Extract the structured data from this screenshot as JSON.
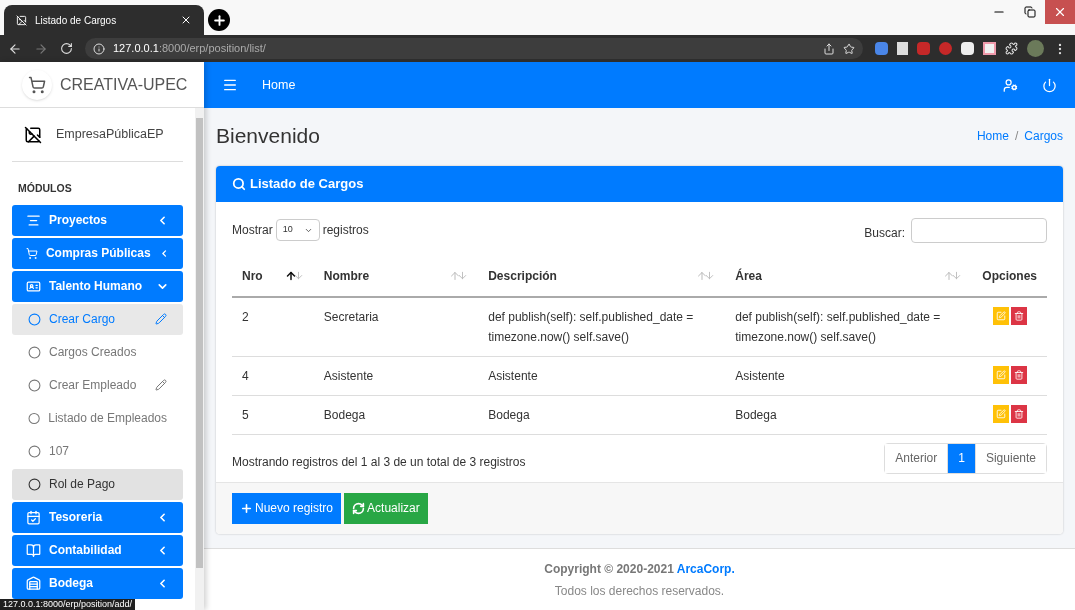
{
  "browser": {
    "tab_title": "Listado de Cargos",
    "address_host": "127.0.0.1",
    "address_path": ":8000/erp/position/list/",
    "status_url": "127.0.0.1:8000/erp/position/add/"
  },
  "sidebar": {
    "brand": "CREATIVA-UPEC",
    "company": "EmpresaPúblicaEP",
    "section": "MÓDULOS",
    "items": [
      {
        "kind": "module",
        "label": "Proyectos",
        "expanded": false
      },
      {
        "kind": "module",
        "label": "Compras Públicas",
        "expanded": false
      },
      {
        "kind": "module",
        "label": "Talento Humano",
        "expanded": true
      },
      {
        "kind": "subitem",
        "label": "Crear Cargo",
        "selected": true,
        "hovered": false,
        "edit_icon": true
      },
      {
        "kind": "subitem",
        "label": "Cargos Creados",
        "selected": false,
        "hovered": false,
        "edit_icon": false
      },
      {
        "kind": "subitem",
        "label": "Crear Empleado",
        "selected": false,
        "hovered": false,
        "edit_icon": true
      },
      {
        "kind": "subitem",
        "label": "Listado de Empleados",
        "selected": false,
        "hovered": false,
        "edit_icon": false
      },
      {
        "kind": "subitem",
        "label": "107",
        "selected": false,
        "hovered": false,
        "edit_icon": false
      },
      {
        "kind": "subitem",
        "label": "Rol de Pago",
        "selected": false,
        "hovered": true,
        "edit_icon": false
      },
      {
        "kind": "module",
        "label": "Tesoreria",
        "expanded": false
      },
      {
        "kind": "module",
        "label": "Contabilidad",
        "expanded": false
      },
      {
        "kind": "module",
        "label": "Bodega",
        "expanded": false
      }
    ]
  },
  "navbar": {
    "home": "Home"
  },
  "page": {
    "title": "Bienvenido",
    "breadcrumb": [
      "Home",
      "Cargos"
    ],
    "breadcrumb_separator": "/"
  },
  "card": {
    "title": "Listado de Cargos",
    "show_prefix": "Mostrar",
    "page_size": "10",
    "show_suffix": "registros",
    "search_label": "Buscar:",
    "columns": [
      {
        "label": "Nro",
        "sortable": true,
        "sorted": true
      },
      {
        "label": "Nombre",
        "sortable": true,
        "sorted": false
      },
      {
        "label": "Descripción",
        "sortable": true,
        "sorted": false
      },
      {
        "label": "Área",
        "sortable": true,
        "sorted": false
      },
      {
        "label": "Opciones"
      }
    ],
    "rows": [
      [
        "2",
        "Secretaria",
        "def publish(self): self.published_date = timezone.now() self.save()",
        "def publish(self): self.published_date = timezone.now() self.save()"
      ],
      [
        "4",
        "Asistente",
        "Asistente",
        "Asistente"
      ],
      [
        "5",
        "Bodega",
        "Bodega",
        "Bodega"
      ]
    ],
    "info": "Mostrando registros del 1 al 3 de un total de 3 registros",
    "pagination": [
      {
        "label": "Anterior",
        "selected": false
      },
      {
        "label": "1",
        "selected": true
      },
      {
        "label": "Siguiente",
        "selected": false
      }
    ],
    "buttons": [
      {
        "kind": "new",
        "label": "Nuevo registro"
      },
      {
        "kind": "refresh",
        "label": "Actualizar"
      }
    ]
  },
  "footer": {
    "copyright": "Copyright © 2020-2021",
    "link": "ArcaCorp.",
    "rights": "Todos los derechos reservados."
  }
}
